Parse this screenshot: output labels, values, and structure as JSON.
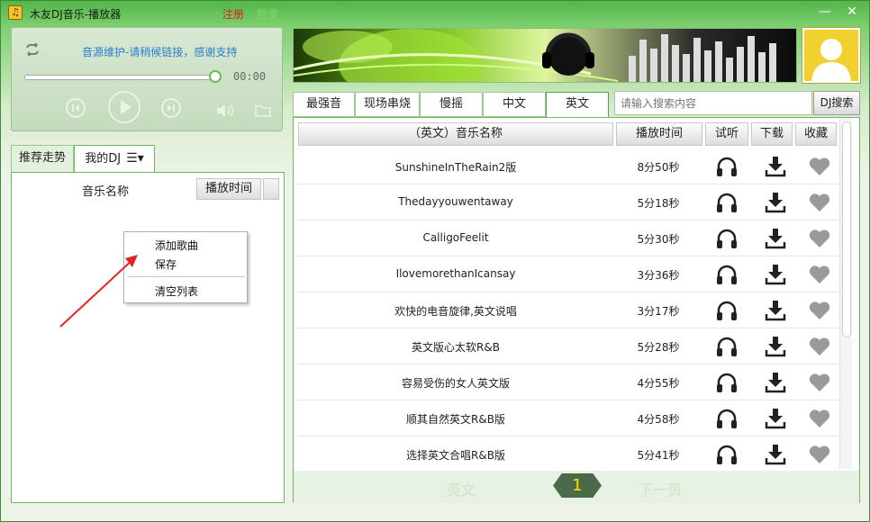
{
  "window": {
    "title": "木友DJ音乐-播放器",
    "register": "注册",
    "login": "登录",
    "app_icon": "music-note-icon",
    "minimize": "—",
    "close": "✕"
  },
  "player": {
    "notice": "音源维护-请稍候链接，感谢支持",
    "time": "00:00",
    "progress_fraction": 1.0
  },
  "left": {
    "tabs": [
      "推荐走势",
      "我的DJ"
    ],
    "menu_glyph": "☰▾",
    "header_name": "音乐名称",
    "header_time": "播放时间",
    "context_menu": [
      "添加歌曲",
      "保存",
      "清空列表"
    ]
  },
  "categories": [
    "最强音",
    "现场串烧",
    "慢摇",
    "中文",
    "英文"
  ],
  "active_category": 4,
  "search": {
    "placeholder": "请输入搜索内容",
    "button": "DJ搜索"
  },
  "table": {
    "headers": [
      "（英文）音乐名称",
      "播放时间",
      "试听",
      "下载",
      "收藏"
    ],
    "rows": [
      {
        "name": "SunshineInTheRain2版",
        "time": "8分50秒"
      },
      {
        "name": "Thedayyouwentaway",
        "time": "5分18秒"
      },
      {
        "name": "CalligoFeelit",
        "time": "5分30秒"
      },
      {
        "name": "IlovemorethanIcansay",
        "time": "3分36秒"
      },
      {
        "name": "欢快的电音旋律,英文说唱",
        "time": "3分17秒"
      },
      {
        "name": "英文版心太软R&B",
        "time": "5分28秒"
      },
      {
        "name": "容易受伤的女人英文版",
        "time": "4分55秒"
      },
      {
        "name": "顺其自然英文R&B版",
        "time": "4分58秒"
      },
      {
        "name": "选择英文合唱R&B版",
        "time": "5分41秒"
      }
    ]
  },
  "pager": {
    "prev": "英文",
    "current": "1",
    "next": "下一页"
  },
  "colors": {
    "accent": "#6cba5c",
    "link": "#2b7fcf",
    "register": "#e31b1b",
    "page_number": "#ffe100"
  }
}
